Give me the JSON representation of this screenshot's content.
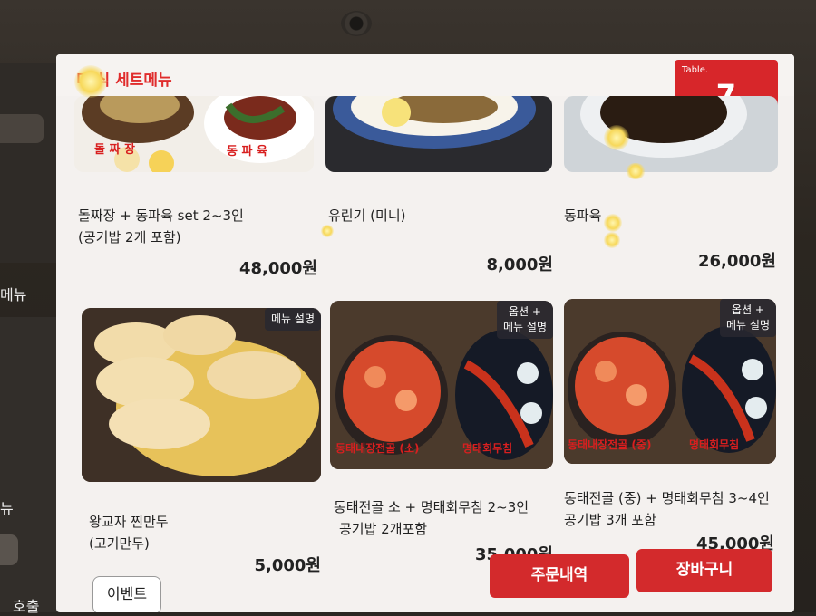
{
  "header": {
    "title": "세트메뉴"
  },
  "table_badge": {
    "label": "Table.",
    "number": "7"
  },
  "sidebar_fragments": {
    "menu": "메뉴",
    "menu2": "뉴",
    "call": "호출"
  },
  "menu_items": [
    {
      "name_line1": "돌짜장 + 동파육 set 2~3인",
      "name_line2": "(공기밥 2개 포함)",
      "price": "48,000원",
      "img_label_1": "돌 짜 장",
      "img_label_2": "동 파 육"
    },
    {
      "name_line1": "유린기 (미니)",
      "name_line2": "",
      "price": "8,000원"
    },
    {
      "name_line1": "동파육",
      "name_line2": "",
      "price": "26,000원"
    },
    {
      "name_line1": "왕교자 찐만두",
      "name_line2": "(고기만두)",
      "price": "5,000원",
      "badge": "메뉴 설명"
    },
    {
      "name_line1": "동태전골 소 + 명태회무침 2~3인",
      "name_line2": "공기밥 2개포함",
      "price": "35,000원",
      "badge_line1": "옵션 +",
      "badge_line2": "메뉴 설명",
      "img_label_1": "동태내장전골 (소)",
      "img_label_2": "명태회무침"
    },
    {
      "name_line1": "동태전골 (중) + 명태회무침 3~4인",
      "name_line2": "공기밥 3개 포함",
      "price": "45,000원",
      "badge_line1": "옵션 +",
      "badge_line2": "메뉴 설명",
      "img_label_1": "동태내장전골 (중)",
      "img_label_2": "명태회무침"
    }
  ],
  "buttons": {
    "order_history": "주문내역",
    "cart": "장바구니",
    "event": "이벤트"
  },
  "icons": [
    "camera-icon"
  ]
}
